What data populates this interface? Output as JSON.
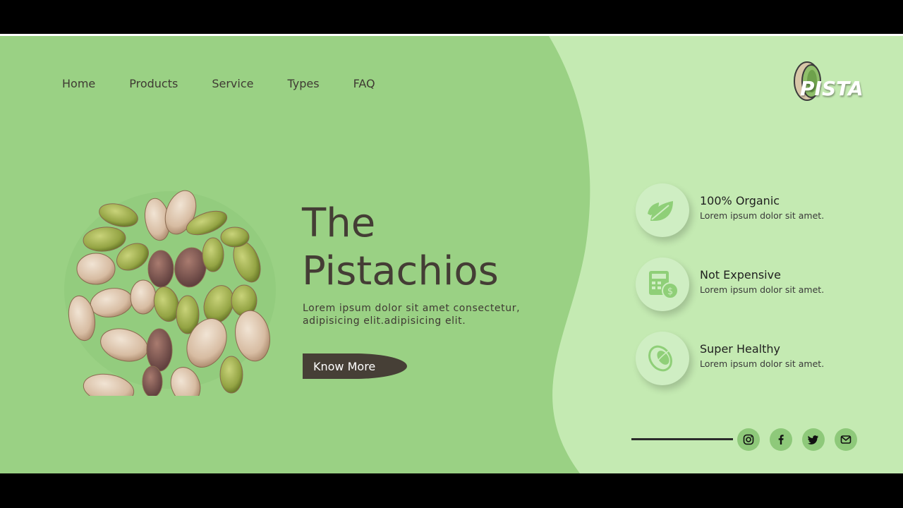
{
  "nav": {
    "items": [
      {
        "label": "Home"
      },
      {
        "label": "Products"
      },
      {
        "label": "Service"
      },
      {
        "label": "Types"
      },
      {
        "label": "FAQ"
      }
    ]
  },
  "logo": {
    "text": "PISTA"
  },
  "hero": {
    "title_line1": "The",
    "title_line2": "Pistachios",
    "description": "Lorem ipsum dolor sit amet consectetur, adipisicing elit.adipisicing elit.",
    "cta_label": "Know More"
  },
  "features": [
    {
      "title": "100% Organic",
      "subtitle": "Lorem ipsum dolor sit amet.",
      "icon": "leaf-icon"
    },
    {
      "title": "Not Expensive",
      "subtitle": "Lorem ipsum dolor sit amet.",
      "icon": "money-calculator-icon"
    },
    {
      "title": "Super Healthy",
      "subtitle": "Lorem ipsum dolor sit amet.",
      "icon": "pistachio-icon"
    }
  ],
  "social": [
    "instagram-icon",
    "facebook-icon",
    "twitter-icon",
    "mail-icon"
  ],
  "colors": {
    "left_panel": "#9ad184",
    "right_panel": "#c4eab2",
    "text_dark": "#443d35",
    "button_bg": "#463f36",
    "social_bg": "#8ec97a"
  }
}
